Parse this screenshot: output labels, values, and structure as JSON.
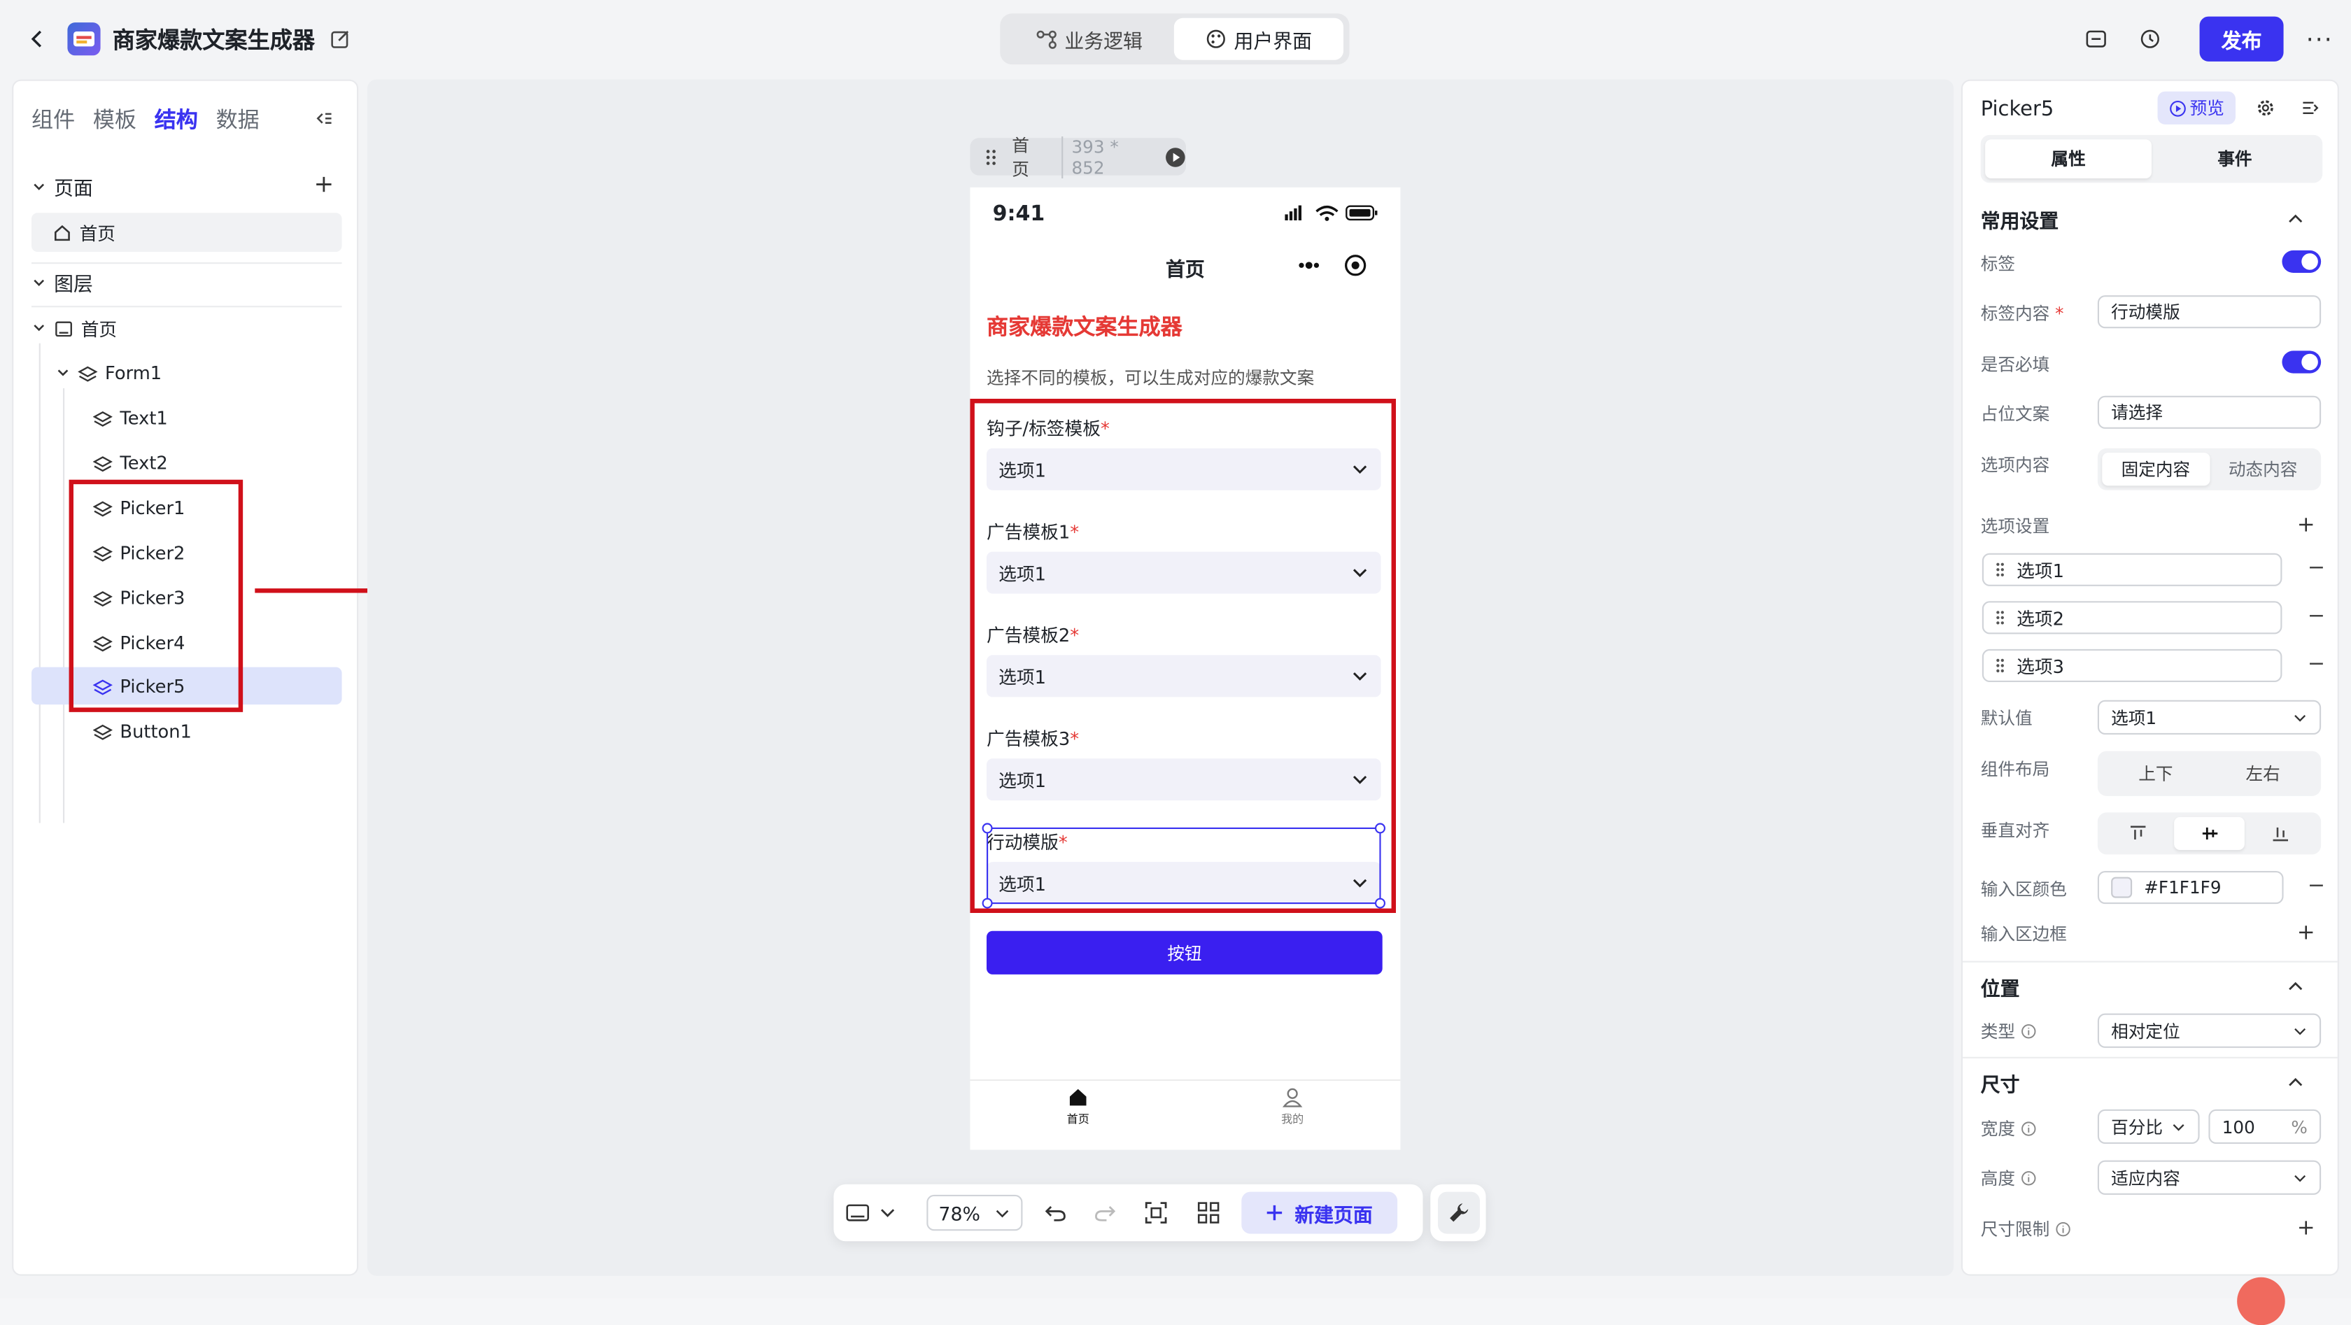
{
  "app": {
    "title": "商家爆款文案生成器",
    "publish_label": "发布"
  },
  "top_tabs": [
    {
      "label": "业务逻辑"
    },
    {
      "label": "用户界面"
    }
  ],
  "left": {
    "tabs": [
      "组件",
      "模板",
      "结构",
      "数据"
    ],
    "pages_label": "页面",
    "page_item": "首页",
    "layers_label": "图层",
    "tree": {
      "root": "首页",
      "form": "Form1",
      "children": [
        "Text1",
        "Text2",
        "Picker1",
        "Picker2",
        "Picker3",
        "Picker4",
        "Picker5",
        "Button1"
      ]
    }
  },
  "canvas": {
    "page_name": "首页",
    "page_size": "393 * 852",
    "status_time": "9:41",
    "nav_title": "首页",
    "heading": "商家爆款文案生成器",
    "subtitle": "选择不同的模板，可以生成对应的爆款文案",
    "pickers": [
      {
        "label": "钩子/标签模板",
        "value": "选项1"
      },
      {
        "label": "广告模板1",
        "value": "选项1"
      },
      {
        "label": "广告模板2",
        "value": "选项1"
      },
      {
        "label": "广告模板3",
        "value": "选项1"
      },
      {
        "label": "行动模版",
        "value": "选项1"
      }
    ],
    "required_mark": "*",
    "button_label": "按钮",
    "tabbar": [
      {
        "label": "首页"
      },
      {
        "label": "我的"
      }
    ]
  },
  "bottom_toolbar": {
    "zoom": "78%",
    "new_page_label": "新建页面"
  },
  "right": {
    "component_name": "Picker5",
    "preview_label": "预览",
    "tabs": [
      "属性",
      "事件"
    ],
    "common_settings": "常用设置",
    "label_label": "标签",
    "label_content_label": "标签内容",
    "label_content_value": "行动模版",
    "required_label": "是否必填",
    "placeholder_label": "占位文案",
    "placeholder_value": "请选择",
    "options_content_label": "选项内容",
    "options_content_seg": [
      "固定内容",
      "动态内容"
    ],
    "options_settings_label": "选项设置",
    "options": [
      "选项1",
      "选项2",
      "选项3"
    ],
    "default_label": "默认值",
    "default_value": "选项1",
    "layout_label": "组件布局",
    "layout_seg": [
      "上下",
      "左右"
    ],
    "valign_label": "垂直对齐",
    "input_color_label": "输入区颜色",
    "input_color_value": "#F1F1F9",
    "input_border_label": "输入区边框",
    "position_section": "位置",
    "type_label": "类型",
    "type_value": "相对定位",
    "size_section": "尺寸",
    "width_label": "宽度",
    "width_unit": "百分比",
    "width_value": "100",
    "width_pct": "%",
    "height_label": "高度",
    "height_value": "适应内容",
    "size_limit_label": "尺寸限制"
  },
  "colors": {
    "accent": "#3a33f0",
    "annotation": "#d0101a",
    "heading_red": "#e53935"
  }
}
